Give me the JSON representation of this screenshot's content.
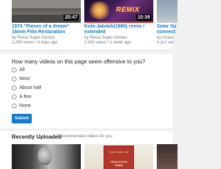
{
  "videos": [
    {
      "title": "1974 \"Pieces of a dream\" 16mm Film Restoration",
      "channel": "by Rinoa Super-Genius",
      "stats": "2,269 views • 3 days ago",
      "duration": "25:47"
    },
    {
      "title": "Kolo-Jabdah(1986) remix / extended",
      "channel": "by Rinoa Super-Genius",
      "stats": "2,343 views • 1 week ago",
      "duration": "15:39",
      "logo_text": "REMIX"
    },
    {
      "title": "Solar Su connect",
      "channel": "by Rinoa",
      "stats": "4,112 vie"
    }
  ],
  "survey": {
    "question": "How many videos on this page seem offensive to you?",
    "options": [
      "All",
      "Most",
      "About half",
      "A few",
      "None"
    ],
    "submit_label": "Submit"
  },
  "recent": {
    "title": "Recently Uploaded",
    "subtitle": "Recommended videos for you",
    "book_top": "THE STORY OF",
    "book_bottom": "TEAM DOVID TIMES"
  },
  "colors": {
    "link": "#167ac6",
    "background": "#f1f1f1",
    "submit": "#167ac6"
  }
}
